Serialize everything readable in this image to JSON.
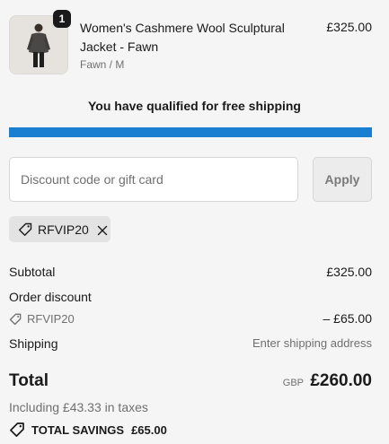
{
  "product": {
    "quantity": "1",
    "name": "Women's Cashmere Wool Sculptural Jacket - Fawn",
    "variant": "Fawn / M",
    "price": "£325.00"
  },
  "shipping_banner": {
    "message": "You have qualified for free shipping",
    "progress": 1.0,
    "bar_color": "#1a7fd0"
  },
  "discount": {
    "placeholder": "Discount code or gift card",
    "apply_label": "Apply",
    "applied_code": "RFVIP20"
  },
  "summary": {
    "subtotal_label": "Subtotal",
    "subtotal_value": "£325.00",
    "order_discount_label": "Order discount",
    "discount_code": "RFVIP20",
    "discount_value": "– £65.00",
    "shipping_label": "Shipping",
    "shipping_value": "Enter shipping address",
    "total_label": "Total",
    "currency": "GBP",
    "total_value": "£260.00",
    "tax_note": "Including £43.33 in taxes",
    "savings_label": "TOTAL SAVINGS",
    "savings_value": "£65.00"
  },
  "icons": {
    "tag": "tag-icon",
    "remove": "close-icon"
  }
}
